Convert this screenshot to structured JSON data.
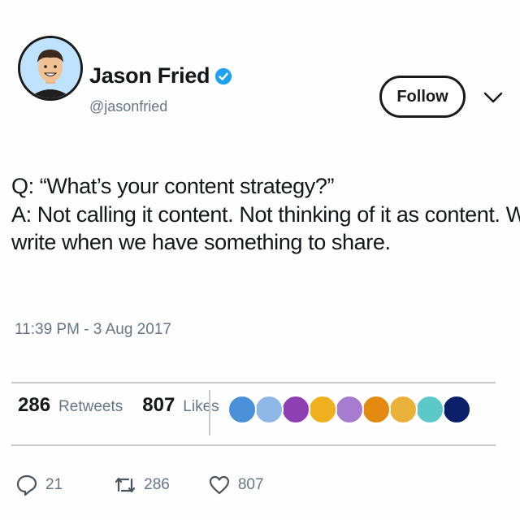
{
  "author": {
    "name": "Jason Fried",
    "handle": "@jasonfried",
    "verified": true
  },
  "follow_label": "Follow",
  "tweet": {
    "lines": [
      "Q: “What’s your content strategy?”",
      "A: Not calling it content. Not thinking of it as content. We",
      "write when we have something to share."
    ],
    "timestamp": "11:39 PM - 3 Aug 2017"
  },
  "stats": {
    "retweets": "286",
    "retweets_label": "Retweets",
    "likes": "807",
    "likes_label": "Likes"
  },
  "likers_colors": [
    "#4a90d9",
    "#8fb8e6",
    "#8e3fb3",
    "#f0b020",
    "#a77bd0",
    "#e58a10",
    "#eab23a",
    "#5cc8c8",
    "#0b1f6b"
  ],
  "actions": {
    "replies": "21",
    "retweets": "286",
    "likes": "807"
  },
  "colors": {
    "verified_blue": "#1da1f2",
    "muted": "#657786"
  }
}
